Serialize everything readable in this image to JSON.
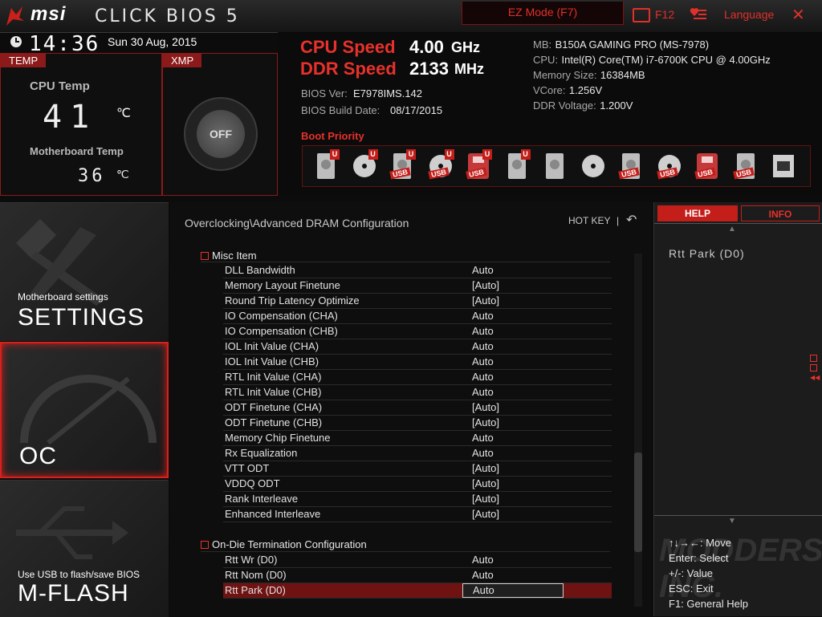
{
  "topbar": {
    "brand": "msi",
    "product": "CLICK BIOS 5",
    "ez_mode": "EZ Mode (F7)",
    "screenshot_key": "F12",
    "language": "Language",
    "close": "✕"
  },
  "status": {
    "time": "14:36",
    "date": "Sun  30 Aug, 2015",
    "temp_tab": "TEMP",
    "xmp_tab": "XMP",
    "cpu_temp_label": "CPU Temp",
    "cpu_temp_value": "41",
    "cpu_temp_unit": "℃",
    "mb_temp_label": "Motherboard Temp",
    "mb_temp_value": "36",
    "mb_temp_unit": "℃",
    "xmp_state": "OFF"
  },
  "speeds": {
    "cpu_label": "CPU Speed",
    "cpu_value": "4.00",
    "cpu_unit": "GHz",
    "ddr_label": "DDR Speed",
    "ddr_value": "2133",
    "ddr_unit": "MHz",
    "bios_ver_label": "BIOS Ver:",
    "bios_ver": "E7978IMS.142",
    "bios_date_label": "BIOS Build Date:",
    "bios_date": "08/17/2015"
  },
  "sysinfo": [
    {
      "label": "MB:",
      "value": "B150A GAMING PRO (MS-7978)"
    },
    {
      "label": "CPU:",
      "value": "Intel(R) Core(TM) i7-6700K CPU @ 4.00GHz"
    },
    {
      "label": "Memory Size:",
      "value": "16384MB"
    },
    {
      "label": "VCore:",
      "value": "1.256V"
    },
    {
      "label": "DDR Voltage:",
      "value": "1.200V"
    }
  ],
  "boot": {
    "title": "Boot Priority",
    "devices": [
      {
        "icon": "hdd-icon",
        "badge": "U",
        "label": ""
      },
      {
        "icon": "disc-icon",
        "badge": "U",
        "label": ""
      },
      {
        "icon": "usb-hdd-icon",
        "badge": "U",
        "label": "USB"
      },
      {
        "icon": "usb-disc-icon",
        "badge": "U",
        "label": "USB"
      },
      {
        "icon": "usb-key-icon",
        "badge": "U",
        "label": "USB"
      },
      {
        "icon": "floppy-icon",
        "badge": "U",
        "label": ""
      },
      {
        "icon": "hdd-icon",
        "badge": "",
        "label": ""
      },
      {
        "icon": "disc-icon",
        "badge": "",
        "label": ""
      },
      {
        "icon": "usb-hdd-icon",
        "badge": "",
        "label": "USB"
      },
      {
        "icon": "usb-disc-icon",
        "badge": "",
        "label": "USB"
      },
      {
        "icon": "usb-key-icon",
        "badge": "",
        "label": "USB"
      },
      {
        "icon": "usb-floppy-icon",
        "badge": "",
        "label": "USB"
      },
      {
        "icon": "network-icon",
        "badge": "",
        "label": ""
      }
    ]
  },
  "nav": {
    "settings_sub": "Motherboard settings",
    "settings": "SETTINGS",
    "oc": "OC",
    "mflash_sub": "Use USB to flash/save BIOS",
    "mflash": "M-FLASH"
  },
  "main": {
    "breadcrumb": "Overclocking\\Advanced DRAM Configuration",
    "hotkey": "HOT KEY",
    "hotkey_sep": "|",
    "back": "↶",
    "group1": "Misc Item",
    "group2": "On-Die Termination Configuration",
    "group1_rows": [
      {
        "label": "DLL Bandwidth",
        "value": "Auto"
      },
      {
        "label": "Memory Layout Finetune",
        "value": "[Auto]"
      },
      {
        "label": "Round Trip Latency Optimize",
        "value": "[Auto]"
      },
      {
        "label": "IO Compensation (CHA)",
        "value": "Auto"
      },
      {
        "label": "IO Compensation (CHB)",
        "value": "Auto"
      },
      {
        "label": "IOL Init Value (CHA)",
        "value": "Auto"
      },
      {
        "label": "IOL Init Value (CHB)",
        "value": "Auto"
      },
      {
        "label": "RTL Init Value (CHA)",
        "value": "Auto"
      },
      {
        "label": "RTL Init Value (CHB)",
        "value": "Auto"
      },
      {
        "label": "ODT Finetune (CHA)",
        "value": "[Auto]"
      },
      {
        "label": "ODT Finetune (CHB)",
        "value": "[Auto]"
      },
      {
        "label": "Memory Chip Finetune",
        "value": "Auto"
      },
      {
        "label": "Rx Equalization",
        "value": "Auto"
      },
      {
        "label": "VTT ODT",
        "value": "[Auto]"
      },
      {
        "label": "VDDQ ODT",
        "value": "[Auto]"
      },
      {
        "label": "Rank Interleave",
        "value": "[Auto]"
      },
      {
        "label": "Enhanced Interleave",
        "value": "[Auto]"
      }
    ],
    "group2_rows": [
      {
        "label": "Rtt Wr (D0)",
        "value": "Auto"
      },
      {
        "label": "Rtt Nom (D0)",
        "value": "Auto"
      },
      {
        "label": "Rtt Park (D0)",
        "value": "Auto"
      }
    ]
  },
  "help": {
    "help_tab": "HELP",
    "info_tab": "INFO",
    "topic": "Rtt Park (D0)",
    "keys": [
      "↑↓→←:  Move",
      "Enter:  Select",
      "+/-:  Value",
      "ESC:  Exit",
      "F1:  General Help"
    ]
  },
  "watermark": "MODDERS INC."
}
